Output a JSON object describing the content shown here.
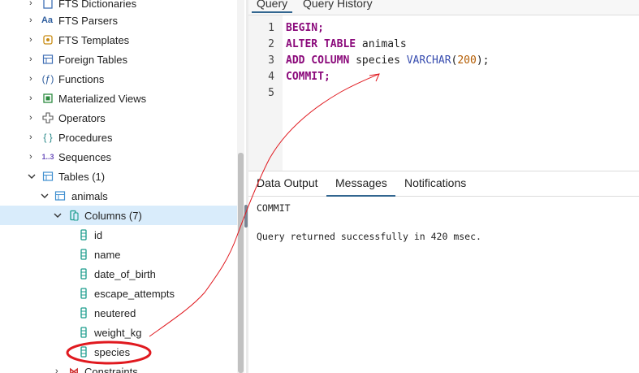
{
  "tree": {
    "items": [
      {
        "label": "FTS Dictionaries",
        "icon": "fts-dictionaries-icon",
        "expanded": false
      },
      {
        "label": "FTS Parsers",
        "icon": "fts-parsers-icon",
        "expanded": false
      },
      {
        "label": "FTS Templates",
        "icon": "fts-templates-icon",
        "expanded": false
      },
      {
        "label": "Foreign Tables",
        "icon": "foreign-tables-icon",
        "expanded": false
      },
      {
        "label": "Functions",
        "icon": "functions-icon",
        "expanded": false
      },
      {
        "label": "Materialized Views",
        "icon": "materialized-views-icon",
        "expanded": false
      },
      {
        "label": "Operators",
        "icon": "operators-icon",
        "expanded": false
      },
      {
        "label": "Procedures",
        "icon": "procedures-icon",
        "expanded": false
      },
      {
        "label": "Sequences",
        "icon": "sequences-icon",
        "expanded": false
      },
      {
        "label": "Tables (1)",
        "icon": "tables-icon",
        "expanded": true
      },
      {
        "label": "animals",
        "icon": "table-icon",
        "expanded": true
      },
      {
        "label": "Columns (7)",
        "icon": "columns-icon",
        "expanded": true,
        "selected": true
      },
      {
        "label": "id",
        "icon": "column-icon"
      },
      {
        "label": "name",
        "icon": "column-icon"
      },
      {
        "label": "date_of_birth",
        "icon": "column-icon"
      },
      {
        "label": "escape_attempts",
        "icon": "column-icon"
      },
      {
        "label": "neutered",
        "icon": "column-icon"
      },
      {
        "label": "weight_kg",
        "icon": "column-icon"
      },
      {
        "label": "species",
        "icon": "column-icon",
        "highlighted": true
      },
      {
        "label": "Constraints",
        "icon": "constraints-icon",
        "expanded": false
      }
    ],
    "sequences_glyph": "1..3",
    "fts_parsers_glyph": "Aa"
  },
  "editor": {
    "tabs": [
      {
        "label": "Query",
        "active": true
      },
      {
        "label": "Query History",
        "active": false
      }
    ],
    "line_numbers": [
      "1",
      "2",
      "3",
      "4",
      "5"
    ],
    "lines": {
      "l1_kw": "BEGIN;",
      "l2_kw": "ALTER TABLE",
      "l2_rest": " animals",
      "l3_kw": "ADD COLUMN",
      "l3_rest": " species ",
      "l3_type": "VARCHAR",
      "l3_open": "(",
      "l3_num": "200",
      "l3_close": ");",
      "l4_kw": "COMMIT;"
    }
  },
  "results": {
    "tabs": [
      {
        "label": "Data Output",
        "active": false
      },
      {
        "label": "Messages",
        "active": true
      },
      {
        "label": "Notifications",
        "active": false
      }
    ],
    "messages": [
      "COMMIT",
      "Query returned successfully in 420 msec."
    ]
  },
  "colors": {
    "selection": "#d9ecfb",
    "accent": "#326690",
    "keyword": "#8b0a7b",
    "annotation": "#e0191f"
  }
}
